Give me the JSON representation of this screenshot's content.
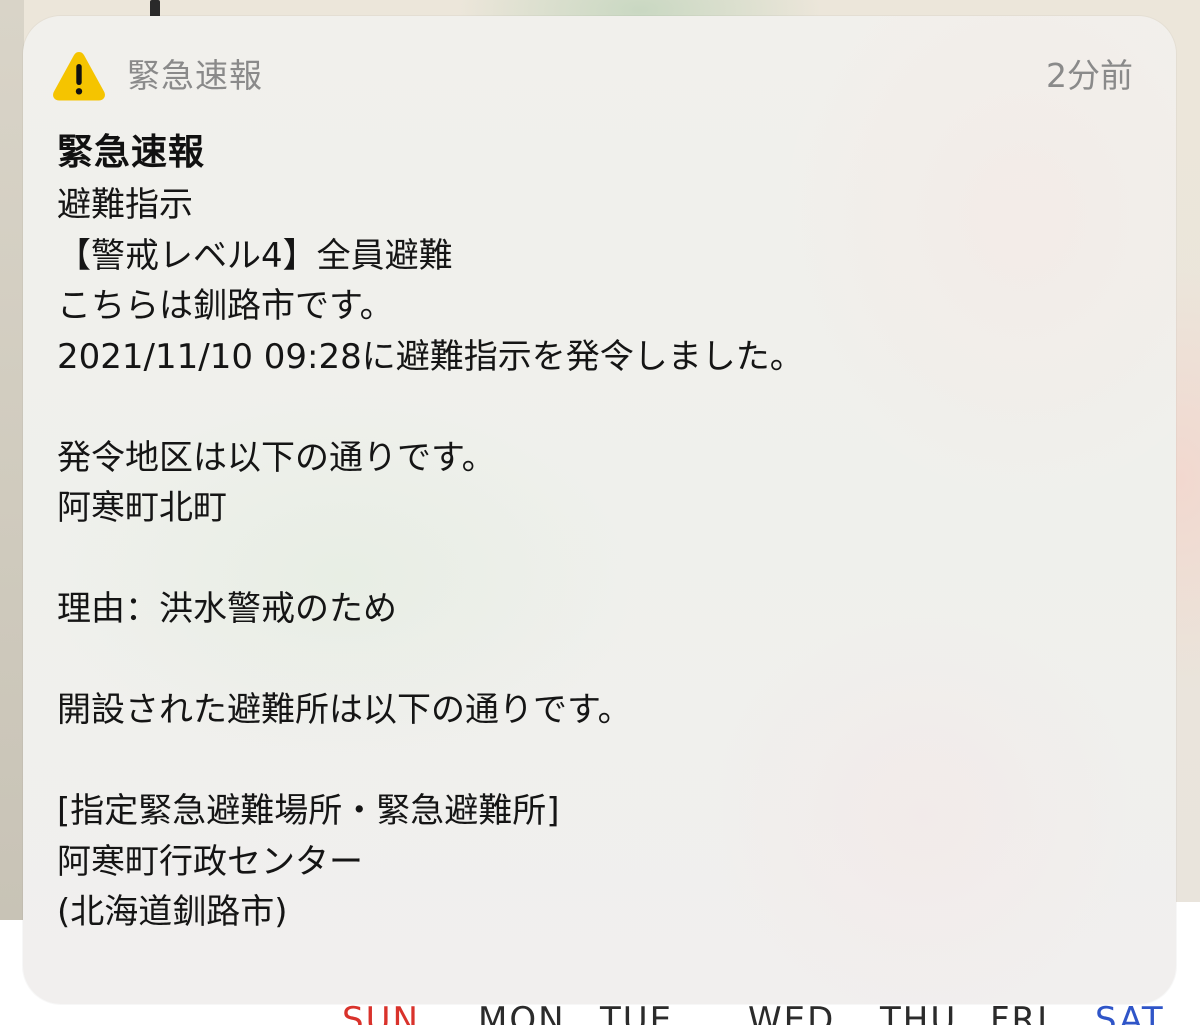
{
  "notification": {
    "app_name": "緊急速報",
    "time_ago": "2分前",
    "icon": "warning-triangle-icon",
    "icon_color": "#f5c400",
    "title": "緊急速報",
    "lines": [
      "避難指示",
      "【警戒レベル4】全員避難",
      "こちらは釧路市です。",
      "2021/11/10 09:28に避難指示を発令しました。",
      "",
      "発令地区は以下の通りです。",
      "阿寒町北町",
      "",
      "理由：洪水警戒のため",
      "",
      "開設された避難所は以下の通りです。",
      "",
      "[指定緊急避難場所・緊急避難所]",
      "阿寒町行政センター",
      "(北海道釧路市)"
    ]
  },
  "background": {
    "calendar_days": [
      "SUN",
      "MON",
      "TUE",
      "WED",
      "THU",
      "FRI",
      "SAT"
    ]
  }
}
